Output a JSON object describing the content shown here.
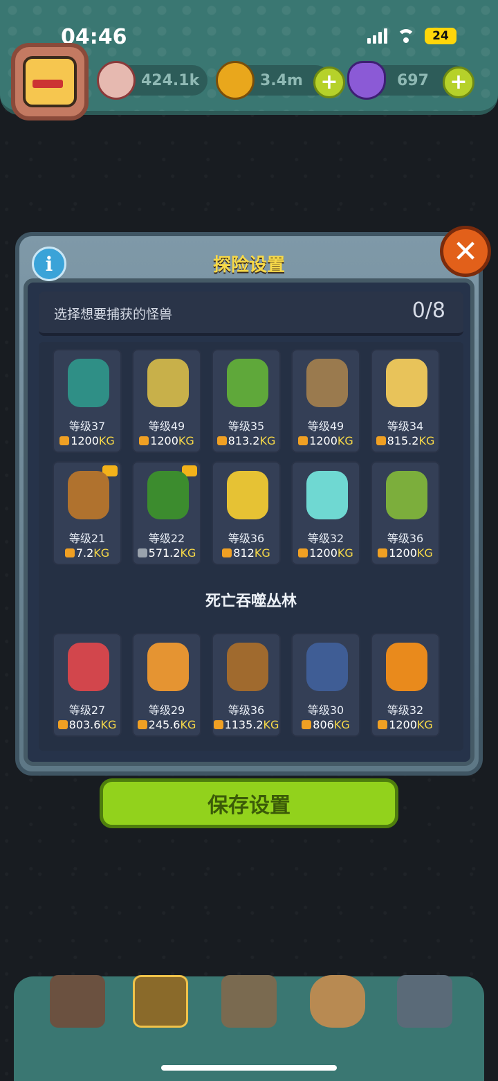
{
  "status_bar": {
    "time": "04:46",
    "battery": "24"
  },
  "resources": {
    "eyeball": "424.1k",
    "coin": "3.4m",
    "potion": "697"
  },
  "colors": {
    "accent_green": "#92d21c",
    "title_yellow": "#f7d948",
    "weight_yellow": "#f7d948"
  },
  "dialog": {
    "title": "探险设置",
    "select_label": "选择想要捕获的怪兽",
    "select_count": "0/8",
    "section_title": "死亡吞噬丛林",
    "save_label": "保存设置",
    "kg_unit": "KG"
  },
  "monsters_row1": [
    {
      "level": "等级37",
      "weight": "1200"
    },
    {
      "level": "等级49",
      "weight": "1200"
    },
    {
      "level": "等级35",
      "weight": "813.2"
    },
    {
      "level": "等级49",
      "weight": "1200"
    },
    {
      "level": "等级34",
      "weight": "815.2"
    }
  ],
  "monsters_row2": [
    {
      "level": "等级21",
      "weight": "7.2"
    },
    {
      "level": "等级22",
      "weight": "571.2"
    },
    {
      "level": "等级36",
      "weight": "812"
    },
    {
      "level": "等级32",
      "weight": "1200"
    },
    {
      "level": "等级36",
      "weight": "1200"
    }
  ],
  "monsters_row3": [
    {
      "level": "等级27",
      "weight": "803.6"
    },
    {
      "level": "等级29",
      "weight": "245.6"
    },
    {
      "level": "等级36",
      "weight": "1135.2"
    },
    {
      "level": "等级30",
      "weight": "806"
    },
    {
      "level": "等级32",
      "weight": "1200"
    }
  ],
  "nav": [
    "shop-icon",
    "monster-icon",
    "book-icon",
    "bag-icon",
    "grid-icon"
  ]
}
